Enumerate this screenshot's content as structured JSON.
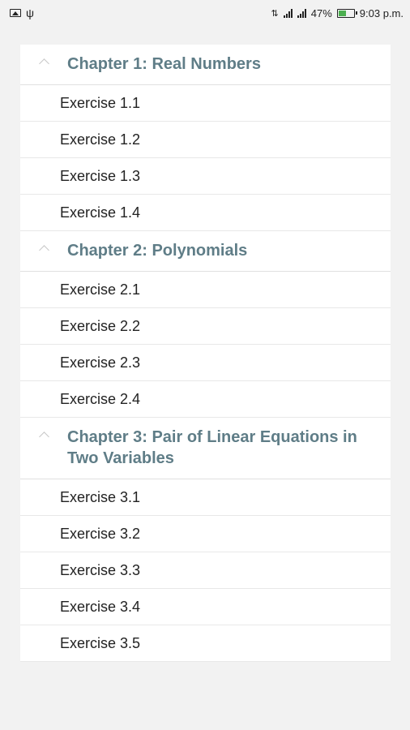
{
  "status_bar": {
    "battery_percent": "47%",
    "time": "9:03 p.m.",
    "left_icons": [
      "image-icon",
      "usb-icon"
    ],
    "right_icons": [
      "data-signal-icon",
      "signal-icon",
      "signal-icon",
      "battery-icon"
    ]
  },
  "chapters": [
    {
      "title": "Chapter 1: Real Numbers",
      "exercises": [
        "Exercise 1.1",
        "Exercise 1.2",
        "Exercise 1.3",
        "Exercise 1.4"
      ]
    },
    {
      "title": "Chapter 2: Polynomials",
      "exercises": [
        "Exercise 2.1",
        "Exercise 2.2",
        "Exercise 2.3",
        "Exercise 2.4"
      ]
    },
    {
      "title": "Chapter 3: Pair of Linear Equations in Two Variables",
      "exercises": [
        "Exercise 3.1",
        "Exercise 3.2",
        "Exercise 3.3",
        "Exercise 3.4",
        "Exercise 3.5"
      ]
    }
  ],
  "colors": {
    "chapter_title": "#5f7d87",
    "background": "#f2f2f2",
    "card": "#ffffff",
    "battery_fill": "#4caf50"
  }
}
